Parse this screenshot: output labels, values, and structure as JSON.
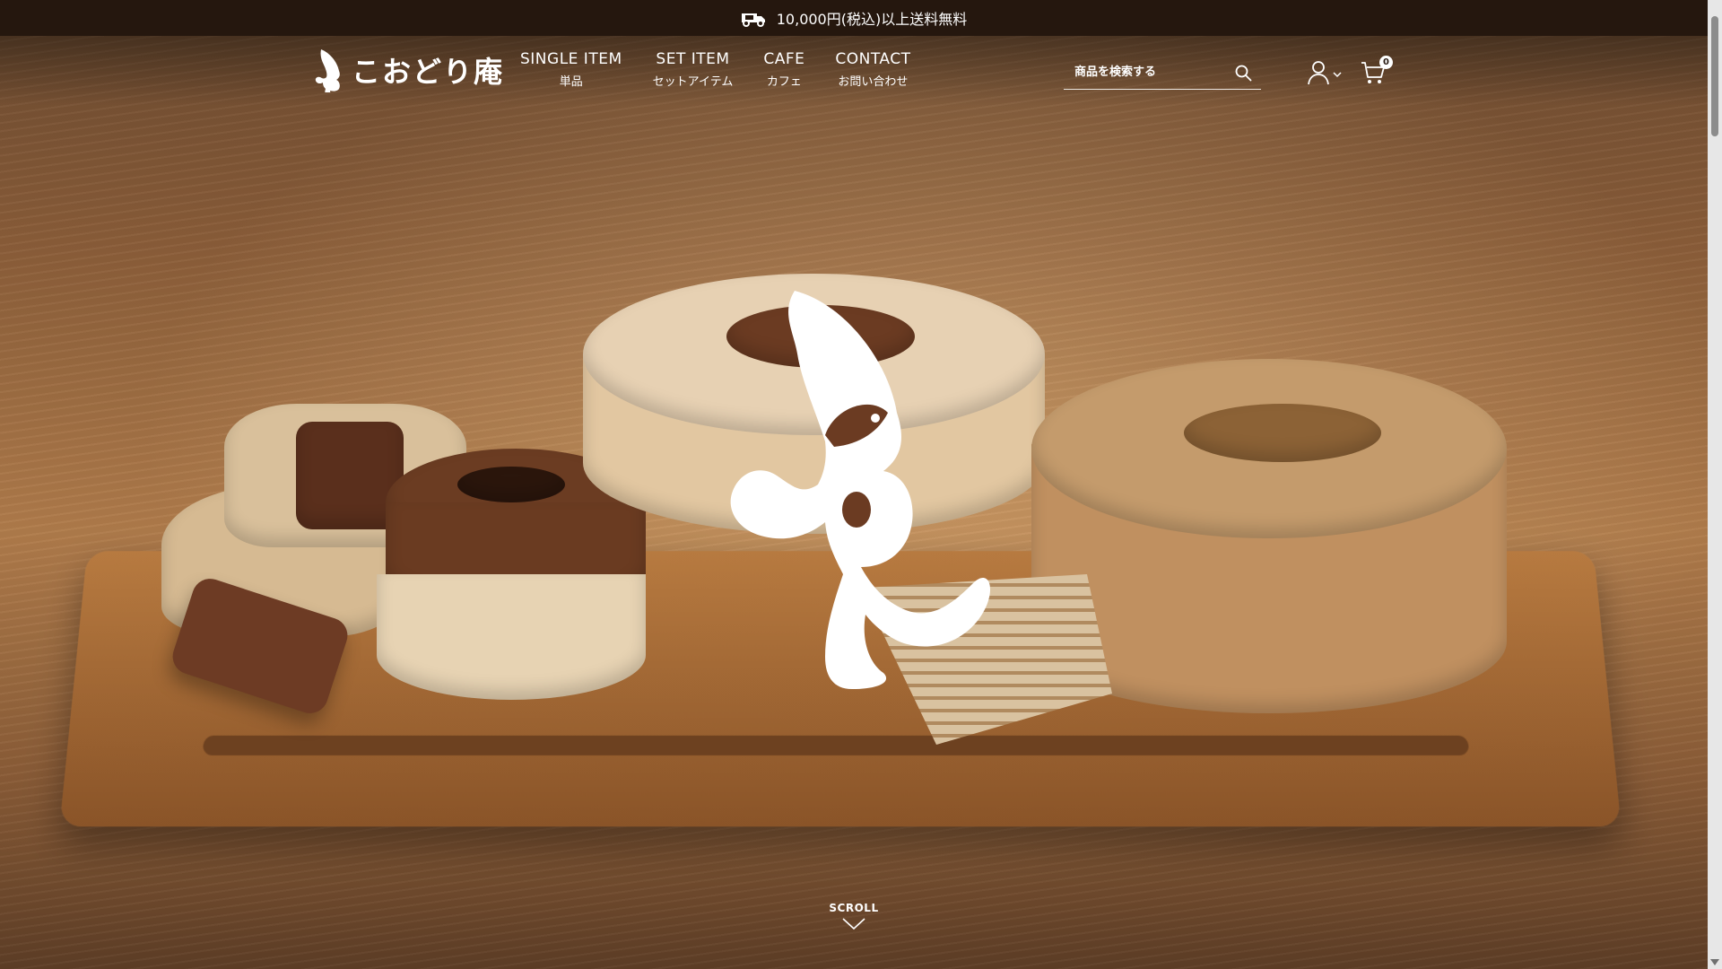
{
  "announcement": {
    "icon": "delivery-truck-icon",
    "text": "10,000円(税込)以上送料無料"
  },
  "brand": {
    "name": "こおどり庵",
    "logo_icon": "dancing-gnome-icon"
  },
  "nav": {
    "items": [
      {
        "en": "SINGLE ITEM",
        "ja": "単品"
      },
      {
        "en": "SET ITEM",
        "ja": "セットアイテム"
      },
      {
        "en": "CAFE",
        "ja": "カフェ"
      },
      {
        "en": "CONTACT",
        "ja": "お問い合わせ"
      }
    ]
  },
  "search": {
    "placeholder": "商品を検索する",
    "icon": "search-icon"
  },
  "account": {
    "icon": "user-icon",
    "dropdown_icon": "chevron-down-icon"
  },
  "cart": {
    "icon": "cart-icon",
    "count": "0"
  },
  "hero": {
    "scroll_label": "SCROLL",
    "scroll_icon": "chevron-down-icon"
  },
  "colors": {
    "announcement_bg": "#25170e",
    "text_light": "#ffffff"
  }
}
